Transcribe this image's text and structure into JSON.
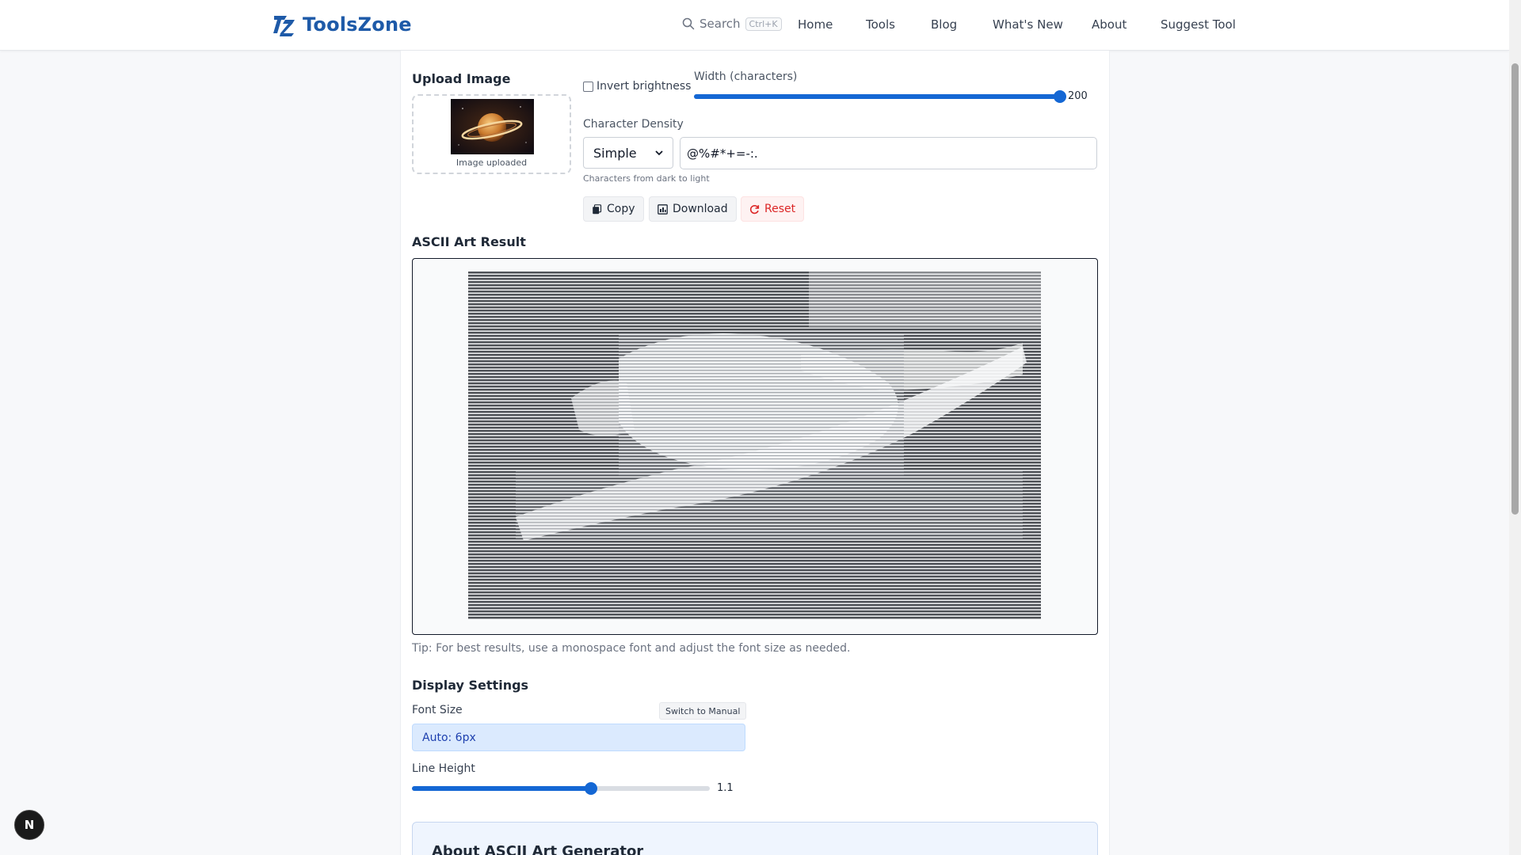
{
  "header": {
    "brand": "ToolsZone",
    "search_label": "Search",
    "search_shortcut": "Ctrl+K",
    "nav": [
      "Home",
      "Tools",
      "Blog",
      "What's New",
      "About",
      "Suggest Tool"
    ]
  },
  "upload": {
    "title": "Upload Image",
    "caption": "Image uploaded"
  },
  "options": {
    "invert_label": "Invert brightness",
    "invert_checked": false,
    "width_label": "Width (characters)",
    "width_value": "200",
    "width_fraction": 1.0,
    "density_label": "Character Density",
    "density_selected": "Simple",
    "chars_value": "@%#*+=-:.",
    "chars_hint": "Characters from dark to light"
  },
  "actions": {
    "copy": "Copy",
    "download": "Download",
    "reset": "Reset"
  },
  "result": {
    "title": "ASCII Art Result",
    "tip": "Tip: For best results, use a monospace font and adjust the font size as needed."
  },
  "display": {
    "title": "Display Settings",
    "font_size_label": "Font Size",
    "switch_label": "Switch to Manual",
    "font_size_value": "Auto: 6px",
    "line_height_label": "Line Height",
    "line_height_value": "1.1",
    "line_height_fraction": 0.6
  },
  "about": {
    "title": "About ASCII Art Generator"
  },
  "colors": {
    "brand": "#1e5aa8",
    "accent": "#1467d4",
    "danger": "#dc2626"
  },
  "floating_badge": "N"
}
